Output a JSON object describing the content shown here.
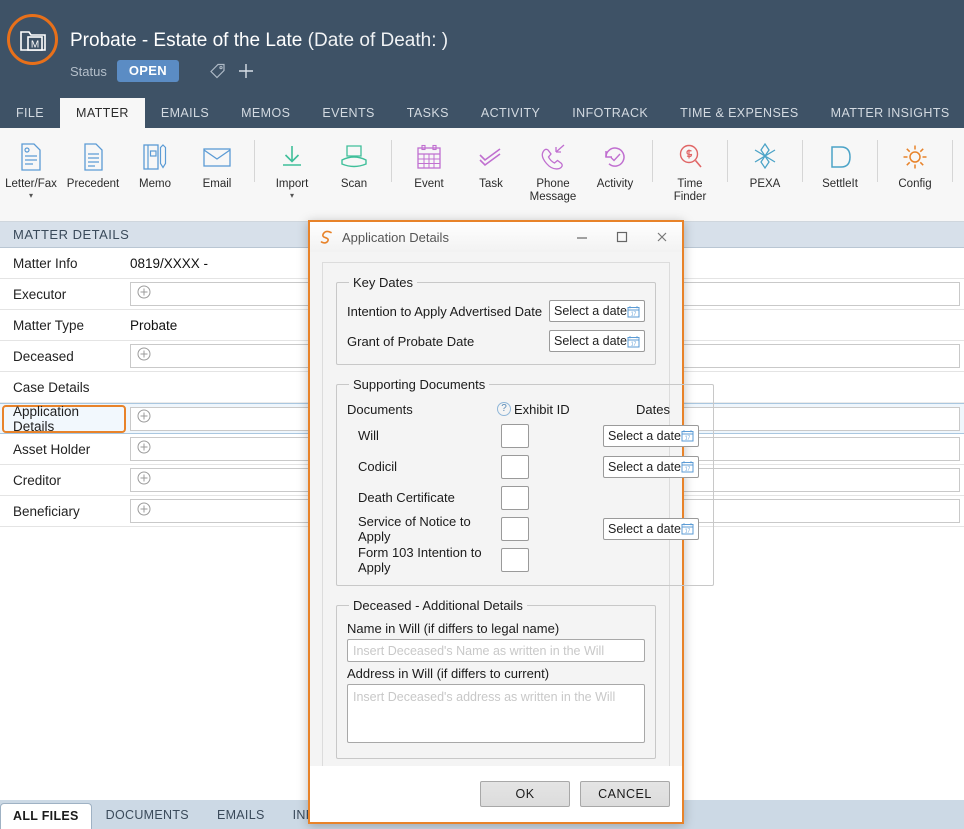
{
  "header": {
    "logo_icon": "matter-folder-m-icon",
    "title_main": "Probate - Estate of the Late",
    "title_dod": "(Date of Death: )",
    "status_label": "Status",
    "status_value": "OPEN",
    "tag_icon": "tag-icon",
    "add_icon": "plus-icon",
    "accent_color": "#e8701a",
    "bg_color": "#3e5266"
  },
  "nav_tabs": [
    {
      "label": "FILE",
      "active": false
    },
    {
      "label": "MATTER",
      "active": true
    },
    {
      "label": "EMAILS",
      "active": false
    },
    {
      "label": "MEMOS",
      "active": false
    },
    {
      "label": "EVENTS",
      "active": false
    },
    {
      "label": "TASKS",
      "active": false
    },
    {
      "label": "ACTIVITY",
      "active": false
    },
    {
      "label": "INFOTRACK",
      "active": false
    },
    {
      "label": "TIME & EXPENSES",
      "active": false
    },
    {
      "label": "MATTER INSIGHTS",
      "active": false
    }
  ],
  "ribbon": [
    {
      "label": "Letter/Fax",
      "icon": "letter-fax-icon",
      "color": "#5b9bd5",
      "caret": true
    },
    {
      "label": "Precedent",
      "icon": "precedent-document-icon",
      "color": "#5b9bd5",
      "caret": false
    },
    {
      "label": "Memo",
      "icon": "memo-notebook-pen-icon",
      "color": "#5b9bd5",
      "caret": false
    },
    {
      "label": "Email",
      "icon": "email-envelope-icon",
      "color": "#5b9bd5",
      "caret": false
    },
    {
      "separator": true
    },
    {
      "label": "Import",
      "icon": "import-download-icon",
      "color": "#3fbf9a",
      "caret": true
    },
    {
      "label": "Scan",
      "icon": "scanner-icon",
      "color": "#3fbf9a",
      "caret": false
    },
    {
      "separator": true
    },
    {
      "label": "Event",
      "icon": "calendar-event-icon",
      "color": "#c06fd0",
      "caret": false
    },
    {
      "label": "Task",
      "icon": "task-checklist-icon",
      "color": "#c06fd0",
      "caret": false
    },
    {
      "label": "Phone Message",
      "icon": "phone-message-icon",
      "color": "#c06fd0",
      "caret": false
    },
    {
      "label": "Activity",
      "icon": "activity-history-icon",
      "color": "#c06fd0",
      "caret": false
    },
    {
      "separator": true
    },
    {
      "label": "Time Finder",
      "icon": "time-finder-dollar-search-icon",
      "color": "#e06666",
      "caret": false
    },
    {
      "separator": true
    },
    {
      "label": "PEXA",
      "icon": "pexa-starburst-icon",
      "color": "#4ba3c7",
      "caret": false
    },
    {
      "separator": true
    },
    {
      "label": "SettleIt",
      "icon": "settleit-arrow-icon",
      "color": "#4ba3c7",
      "caret": false
    },
    {
      "separator": true
    },
    {
      "label": "Config",
      "icon": "config-gear-icon",
      "color": "#e8832a",
      "caret": false
    },
    {
      "separator": true
    }
  ],
  "matter_details": {
    "panel_title": "MATTER DETAILS",
    "rows": [
      {
        "label": "Matter Info",
        "type": "text",
        "value": "0819/XXXX -"
      },
      {
        "label": "Executor",
        "type": "field",
        "value": ""
      },
      {
        "label": "Matter Type",
        "type": "text",
        "value": "Probate"
      },
      {
        "label": "Deceased",
        "type": "field",
        "value": ""
      },
      {
        "label": "Case Details",
        "type": "plain",
        "value": ""
      },
      {
        "label": "Application Details",
        "type": "field",
        "value": "",
        "selected": true
      },
      {
        "label": "Asset Holder",
        "type": "field",
        "value": ""
      },
      {
        "label": "Creditor",
        "type": "field",
        "value": ""
      },
      {
        "label": "Beneficiary",
        "type": "field",
        "value": ""
      }
    ]
  },
  "bottom_tabs": [
    {
      "label": "ALL FILES",
      "active": true
    },
    {
      "label": "DOCUMENTS",
      "active": false
    },
    {
      "label": "EMAILS",
      "active": false
    },
    {
      "label": "INFOTRACK",
      "active": false
    }
  ],
  "dialog": {
    "icon": "smokeball-s-icon",
    "title": "Application Details",
    "minimize_icon": "minimize-icon",
    "maximize_icon": "maximize-icon",
    "close_icon": "close-icon",
    "border_color": "#e8832a",
    "key_dates": {
      "legend": "Key Dates",
      "rows": [
        {
          "label": "Intention to Apply Advertised Date",
          "date_button": "Select a date"
        },
        {
          "label": "Grant of Probate Date",
          "date_button": "Select a date"
        }
      ]
    },
    "supporting_documents": {
      "legend": "Supporting Documents",
      "col_documents": "Documents",
      "col_exhibit": "Exhibit ID",
      "col_dates": "Dates",
      "help_icon": "help-question-icon",
      "rows": [
        {
          "label": "Will",
          "exhibit": "",
          "date_button": "Select a date",
          "has_date": true
        },
        {
          "label": "Codicil",
          "exhibit": "",
          "date_button": "Select a date",
          "has_date": true
        },
        {
          "label": "Death Certificate",
          "exhibit": "",
          "date_button": "",
          "has_date": false
        },
        {
          "label": "Service of Notice to Apply",
          "exhibit": "",
          "date_button": "Select a date",
          "has_date": true
        },
        {
          "label": "Form 103 Intention to Apply",
          "exhibit": "",
          "date_button": "",
          "has_date": false
        }
      ]
    },
    "deceased_additional": {
      "legend": "Deceased - Additional Details",
      "name_label": "Name in Will (if differs to legal name)",
      "name_value": "",
      "name_placeholder": "Insert Deceased's Name as written in the Will",
      "address_label": "Address in Will (if differs to current)",
      "address_value": "",
      "address_placeholder": "Insert Deceased's address as written in the Will"
    },
    "ok_label": "OK",
    "cancel_label": "CANCEL"
  }
}
